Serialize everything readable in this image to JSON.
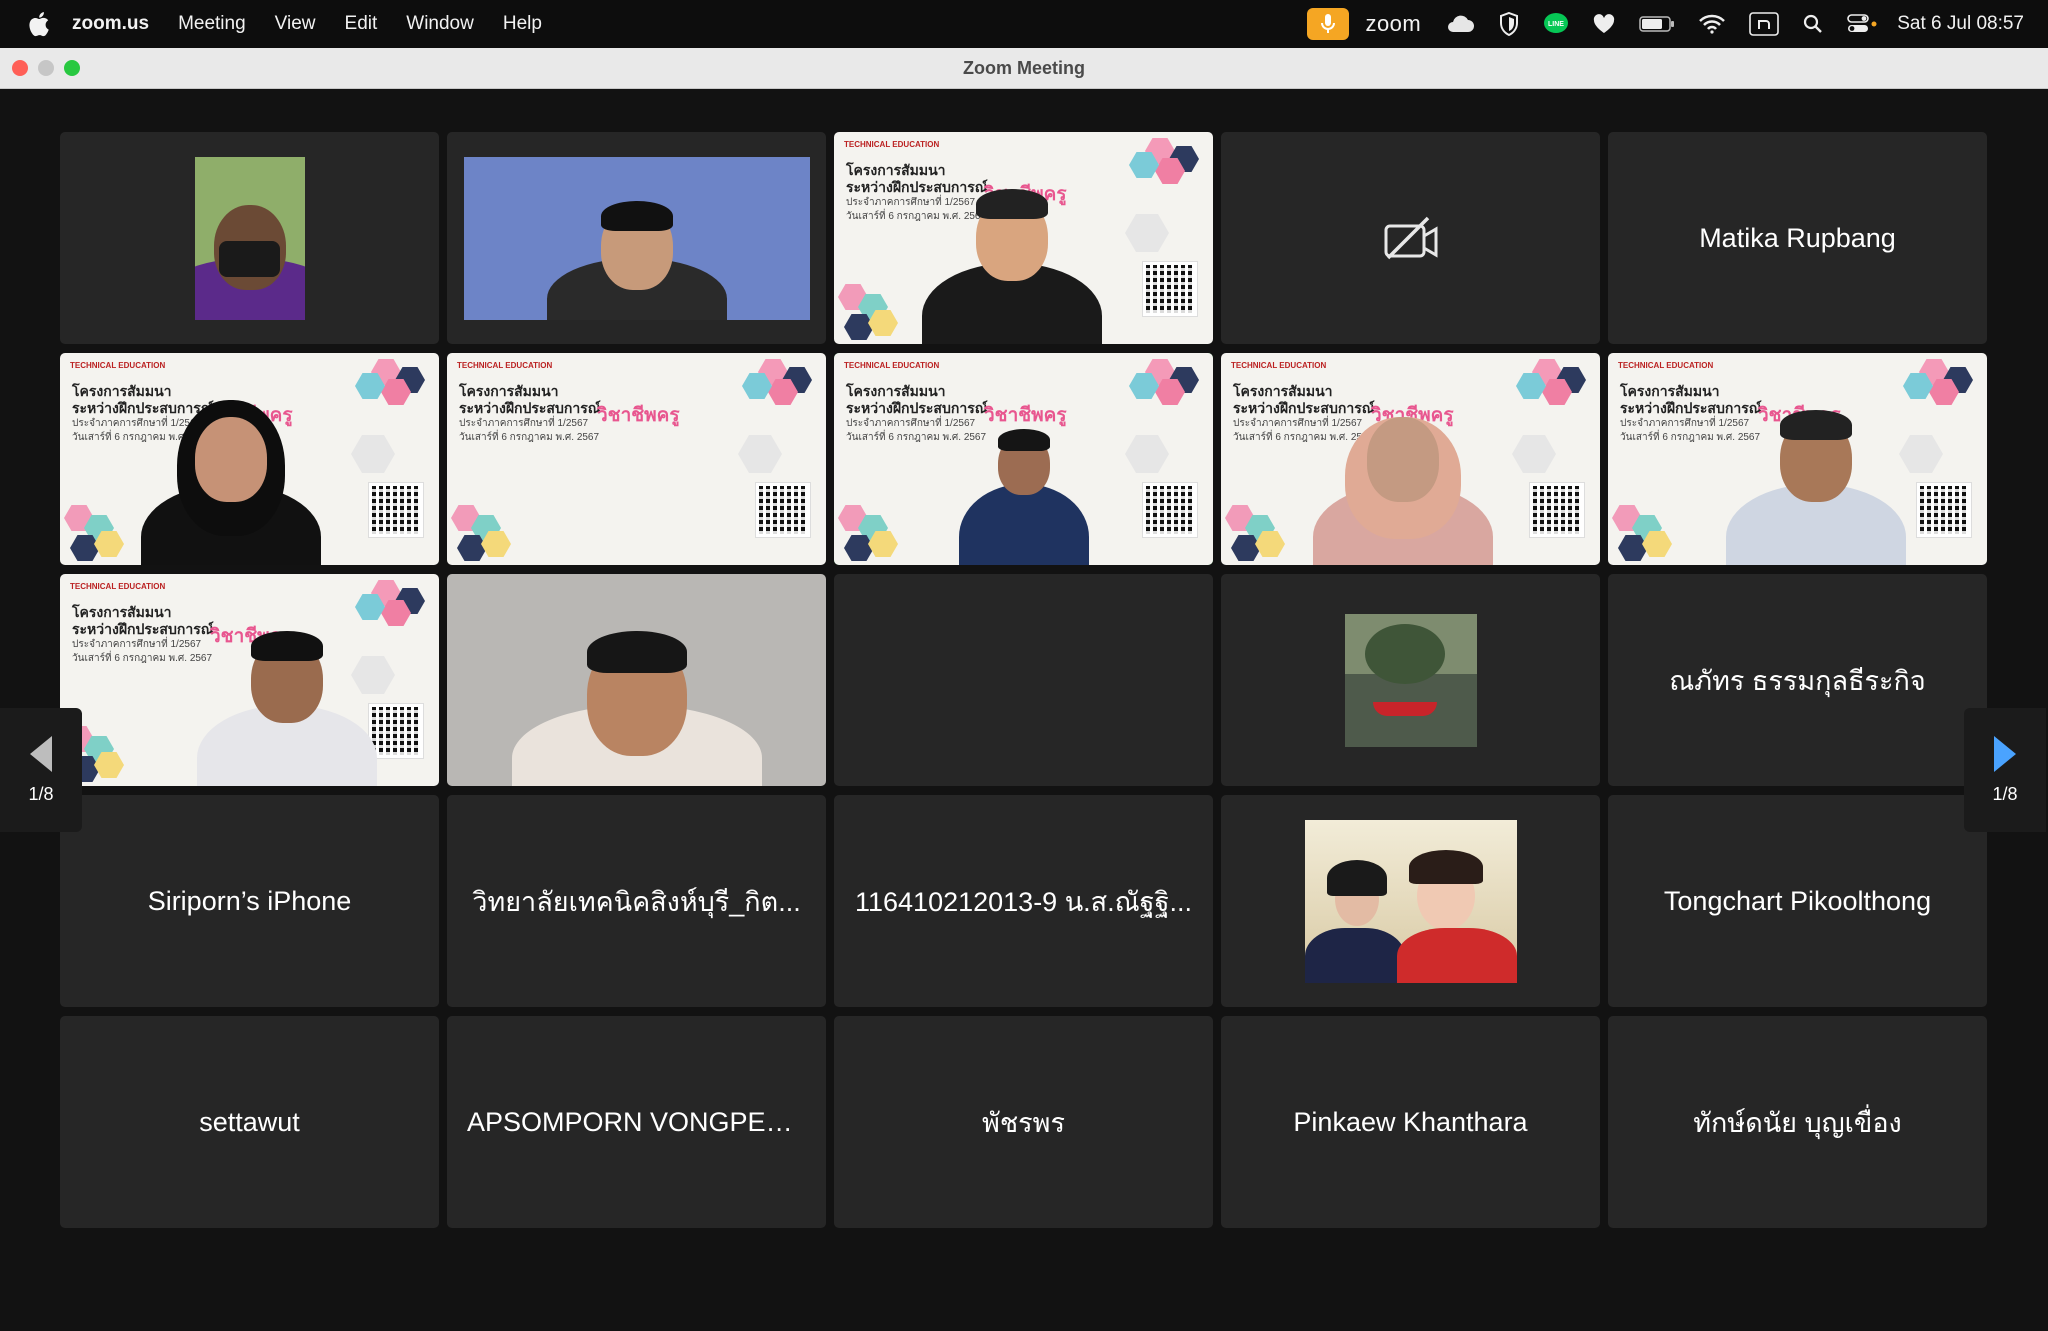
{
  "menubar": {
    "app_name": "zoom.us",
    "menu_items": [
      "Meeting",
      "View",
      "Edit",
      "Window",
      "Help"
    ],
    "zoom_label": "zoom",
    "clock": "Sat 6 Jul  08:57",
    "icons": [
      "mic-icon",
      "cloud-icon",
      "shield-icon",
      "line-icon",
      "heart-icon",
      "battery-icon",
      "wifi-icon",
      "n-icon",
      "search-icon",
      "control-center-icon"
    ],
    "colors": {
      "mic_accent": "#f5a623",
      "line_green": "#06c755"
    }
  },
  "window": {
    "title": "Zoom Meeting",
    "traffic_lights": [
      "#ff5f57",
      "#c6c6c6",
      "#28c840"
    ]
  },
  "pagination": {
    "left_label": "1/8",
    "right_label": "1/8",
    "right_arrow_color": "#4aa3ff"
  },
  "slide": {
    "brand": "TECHNICAL EDUCATION",
    "title_line1": "โครงการสัมมนา",
    "title_line2": "ระหว่างฝึกประสบการณ์",
    "accent": "วิชาชีพครู",
    "sub_line1": "ประจำภาคการศึกษาที่ 1/2567",
    "sub_line2": "วันเสาร์ที่ 6 กรกฎาคม พ.ศ. 2567"
  },
  "tiles": [
    {
      "type": "video"
    },
    {
      "type": "video"
    },
    {
      "type": "slide-video"
    },
    {
      "type": "camera-off",
      "icon": "camera-off-icon"
    },
    {
      "type": "name",
      "name": "Matika Rupbang"
    },
    {
      "type": "slide-video"
    },
    {
      "type": "slide-video"
    },
    {
      "type": "slide-video",
      "active": true
    },
    {
      "type": "slide-video"
    },
    {
      "type": "slide-video"
    },
    {
      "type": "slide-video"
    },
    {
      "type": "video"
    },
    {
      "type": "blank"
    },
    {
      "type": "photo"
    },
    {
      "type": "name",
      "name": "ณภัทร ธรรมกุลธีระกิจ"
    },
    {
      "type": "name",
      "name": "Siriporn’s iPhone"
    },
    {
      "type": "name",
      "name": "วิทยาลัยเทคนิคสิงห์บุรี_กิต..."
    },
    {
      "type": "name",
      "name": "116410212013-9 น.ส.ณัฐฐิ..."
    },
    {
      "type": "photo"
    },
    {
      "type": "name",
      "name": "Tongchart Pikoolthong"
    },
    {
      "type": "name",
      "name": "settawut"
    },
    {
      "type": "name",
      "name": "APSOMPORN VONGPEA..."
    },
    {
      "type": "name",
      "name": "พัชรพร"
    },
    {
      "type": "name",
      "name": "Pinkaew Khanthara"
    },
    {
      "type": "name",
      "name": "ทักษ์ดนัย บุญเขื่อง"
    }
  ]
}
